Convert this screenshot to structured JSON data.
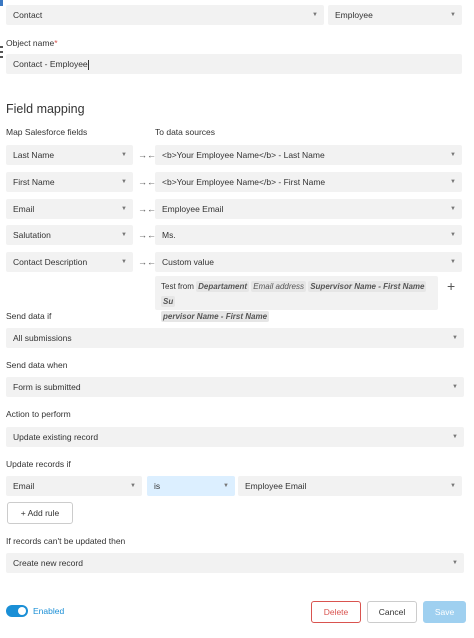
{
  "top": {
    "object_select": "Contact",
    "source_select": "Employee",
    "object_name_label": "Object name",
    "required_mark": "*",
    "object_name_value": "Contact - Employee"
  },
  "field_mapping": {
    "title": "Field mapping",
    "col_left": "Map Salesforce fields",
    "col_right": "To data sources",
    "rows": [
      {
        "field": "Last Name",
        "source": "<b>Your Employee Name</b> - Last Name"
      },
      {
        "field": "First Name",
        "source": "<b>Your Employee Name</b> - First Name"
      },
      {
        "field": "Email",
        "source": "Employee Email"
      },
      {
        "field": "Salutation",
        "source": "Ms."
      },
      {
        "field": "Contact Description",
        "source": "Custom value"
      }
    ],
    "custom_value": {
      "prefix": "Test from",
      "chip1": "Departament",
      "chip2": "Email address",
      "chip3": "Supervisor Name - First Name",
      "chip4a": "Su",
      "chip4b": "pervisor Name - First Name",
      "plus_icon": "+"
    },
    "arrows_glyph": "→←"
  },
  "send_data_if": {
    "label": "Send data if",
    "value": "All submissions"
  },
  "send_data_when": {
    "label": "Send data when",
    "value": "Form is submitted"
  },
  "action": {
    "label": "Action to perform",
    "value": "Update existing record"
  },
  "update_if": {
    "label": "Update records if",
    "field": "Email",
    "operator": "is",
    "value": "Employee Email",
    "add_rule": "+ Add rule"
  },
  "cant_update": {
    "label": "If records can't be updated then",
    "value": "Create new record"
  },
  "footer": {
    "toggle_label": "Enabled",
    "delete": "Delete",
    "cancel": "Cancel",
    "save": "Save"
  },
  "colors": {
    "accent": "#1a8fd6",
    "danger": "#d9534f",
    "save_disabled": "#9fd0f0",
    "operator_bg": "#dcefff"
  }
}
